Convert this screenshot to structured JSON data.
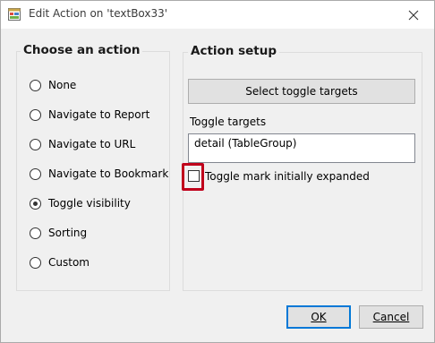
{
  "window": {
    "title": "Edit Action on 'textBox33'",
    "close_glyph": "✕"
  },
  "choose_action": {
    "title": "Choose an action",
    "options": [
      {
        "label": "None",
        "checked": false
      },
      {
        "label": "Navigate to Report",
        "checked": false
      },
      {
        "label": "Navigate to URL",
        "checked": false
      },
      {
        "label": "Navigate to Bookmark",
        "checked": false
      },
      {
        "label": "Toggle visibility",
        "checked": true
      },
      {
        "label": "Sorting",
        "checked": false
      },
      {
        "label": "Custom",
        "checked": false
      }
    ]
  },
  "action_setup": {
    "title": "Action setup",
    "select_button": "Select toggle targets",
    "targets_label": "Toggle targets",
    "targets": [
      "detail (TableGroup)"
    ],
    "checkbox_label": "Toggle mark initially expanded",
    "checkbox_checked": false
  },
  "buttons": {
    "ok": "OK",
    "cancel": "Cancel"
  },
  "colors": {
    "highlight": "#c0001b",
    "default_button_border": "#0078d7"
  }
}
